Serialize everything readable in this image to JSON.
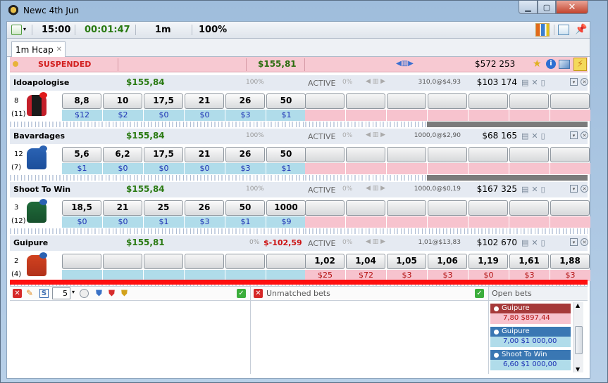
{
  "window": {
    "title": "Newc 4th Jun"
  },
  "toolbar": {
    "time": "15:00",
    "countdown": "00:01:47",
    "distance": "1m",
    "book_pct": "100%"
  },
  "tabs": [
    {
      "label": "1m Hcap"
    }
  ],
  "market": {
    "status": "SUSPENDED",
    "total_stake": "$155,81",
    "matched": "$572 253"
  },
  "runners": [
    {
      "name": "Idoapologise",
      "value": "$155,84",
      "pct_back": "100%",
      "pl": "",
      "status": "ACTIVE",
      "pct_lay": "0%",
      "ltp": "310,0@$4,93",
      "matched": "$103 174",
      "saddle": "8",
      "draw": "(11)",
      "back_prices": [
        "8,8",
        "10",
        "17,5",
        "21",
        "26",
        "50"
      ],
      "back_amounts": [
        "$12",
        "$2",
        "$0",
        "$0",
        "$3",
        "$1"
      ],
      "lay_prices": [
        "",
        "",
        "",
        "",
        "",
        "",
        ""
      ],
      "lay_amounts": [
        "",
        "",
        "",
        "",
        "",
        "",
        ""
      ]
    },
    {
      "name": "Bavardages",
      "value": "$155,84",
      "pct_back": "100%",
      "pl": "",
      "status": "ACTIVE",
      "pct_lay": "0%",
      "ltp": "1000,0@$2,90",
      "matched": "$68 165",
      "saddle": "12",
      "draw": "(7)",
      "back_prices": [
        "5,6",
        "6,2",
        "17,5",
        "21",
        "26",
        "50"
      ],
      "back_amounts": [
        "$1",
        "$0",
        "$0",
        "$0",
        "$3",
        "$1"
      ],
      "lay_prices": [
        "",
        "",
        "",
        "",
        "",
        "",
        ""
      ],
      "lay_amounts": [
        "",
        "",
        "",
        "",
        "",
        "",
        ""
      ]
    },
    {
      "name": "Shoot To Win",
      "value": "$155,84",
      "pct_back": "100%",
      "pl": "",
      "status": "ACTIVE",
      "pct_lay": "0%",
      "ltp": "1000,0@$0,19",
      "matched": "$167 325",
      "saddle": "3",
      "draw": "(12)",
      "back_prices": [
        "18,5",
        "21",
        "25",
        "26",
        "50",
        "1000"
      ],
      "back_amounts": [
        "$0",
        "$0",
        "$1",
        "$3",
        "$1",
        "$9"
      ],
      "lay_prices": [
        "",
        "",
        "",
        "",
        "",
        "",
        ""
      ],
      "lay_amounts": [
        "",
        "",
        "",
        "",
        "",
        "",
        ""
      ]
    },
    {
      "name": "Guipure",
      "value": "$155,81",
      "pct_back": "0%",
      "pl": "$-102,59",
      "status": "ACTIVE",
      "pct_lay": "0%",
      "ltp": "1,01@$13,83",
      "matched": "$102 670",
      "saddle": "2",
      "draw": "(4)",
      "back_prices": [
        "",
        "",
        "",
        "",
        "",
        ""
      ],
      "back_amounts": [
        "",
        "",
        "",
        "",
        "",
        ""
      ],
      "lay_prices": [
        "1,02",
        "1,04",
        "1,05",
        "1,06",
        "1,19",
        "1,61",
        "1,88"
      ],
      "lay_amounts": [
        "$25",
        "$72",
        "$3",
        "$3",
        "$0",
        "$3",
        "$3"
      ]
    }
  ],
  "bottom": {
    "stake_value": "5",
    "unmatched_label": "Unmatched bets",
    "open_label": "Open bets"
  },
  "open_bets": [
    {
      "runner": "Guipure",
      "type": "lay",
      "detail": "7,80   $897,44"
    },
    {
      "runner": "Guipure",
      "type": "back",
      "detail": "7,00   $1 000,00"
    },
    {
      "runner": "Shoot To Win",
      "type": "back",
      "detail": "6,60   $1 000,00"
    }
  ]
}
